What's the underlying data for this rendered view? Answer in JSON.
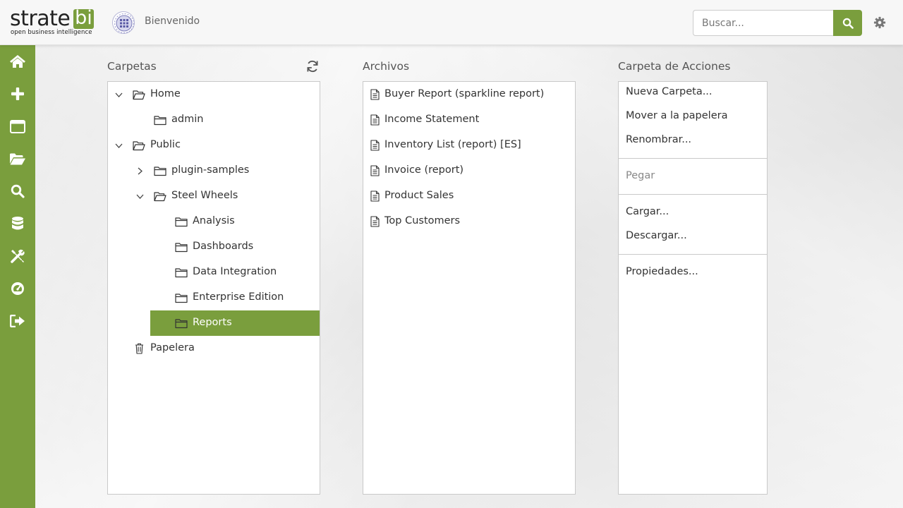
{
  "header": {
    "logo_main": "strate",
    "logo_accent": "bi",
    "logo_tagline": "open business intelligence",
    "welcome": "Bienvenido",
    "search_placeholder": "Buscar...",
    "search_icon": "search-icon",
    "settings_icon": "gear-icon"
  },
  "sidebar": {
    "items": [
      {
        "icon": "home-icon"
      },
      {
        "icon": "plus-icon"
      },
      {
        "icon": "window-icon"
      },
      {
        "icon": "folder-open-icon"
      },
      {
        "icon": "search-icon"
      },
      {
        "icon": "database-icon"
      },
      {
        "icon": "tools-icon"
      },
      {
        "icon": "dashboard-icon"
      },
      {
        "icon": "sign-out-icon"
      }
    ],
    "color": "#7a9e3d"
  },
  "folders": {
    "title": "Carpetas",
    "refresh_icon": "refresh-icon",
    "tree": [
      {
        "label": "Home",
        "expanded": true,
        "icon": "folder-open-icon"
      },
      {
        "label": "admin",
        "icon": "folder-icon"
      },
      {
        "label": "Public",
        "expanded": true,
        "icon": "folder-open-icon"
      },
      {
        "label": "plugin-samples",
        "expanded": false,
        "icon": "folder-icon"
      },
      {
        "label": "Steel Wheels",
        "expanded": true,
        "icon": "folder-open-icon"
      },
      {
        "label": "Analysis",
        "icon": "folder-icon"
      },
      {
        "label": "Dashboards",
        "icon": "folder-icon"
      },
      {
        "label": "Data Integration",
        "icon": "folder-icon"
      },
      {
        "label": "Enterprise Edition",
        "icon": "folder-icon"
      },
      {
        "label": "Reports",
        "icon": "folder-icon",
        "selected": true
      },
      {
        "label": "Papelera",
        "icon": "trash-icon"
      }
    ]
  },
  "files": {
    "title": "Archivos",
    "items": [
      {
        "label": "Buyer Report (sparkline report)"
      },
      {
        "label": "Income Statement"
      },
      {
        "label": "Inventory List (report) [ES]"
      },
      {
        "label": "Invoice (report)"
      },
      {
        "label": "Product Sales"
      },
      {
        "label": "Top Customers"
      }
    ]
  },
  "actions": {
    "title": "Carpeta de Acciones",
    "new_folder": "Nueva Carpeta...",
    "move_trash": "Mover a la papelera",
    "rename": "Renombrar...",
    "paste": "Pegar",
    "upload": "Cargar...",
    "download": "Descargar...",
    "properties": "Propiedades..."
  },
  "colors": {
    "accent": "#7a9e3d",
    "selected_text": "#ffffff"
  }
}
